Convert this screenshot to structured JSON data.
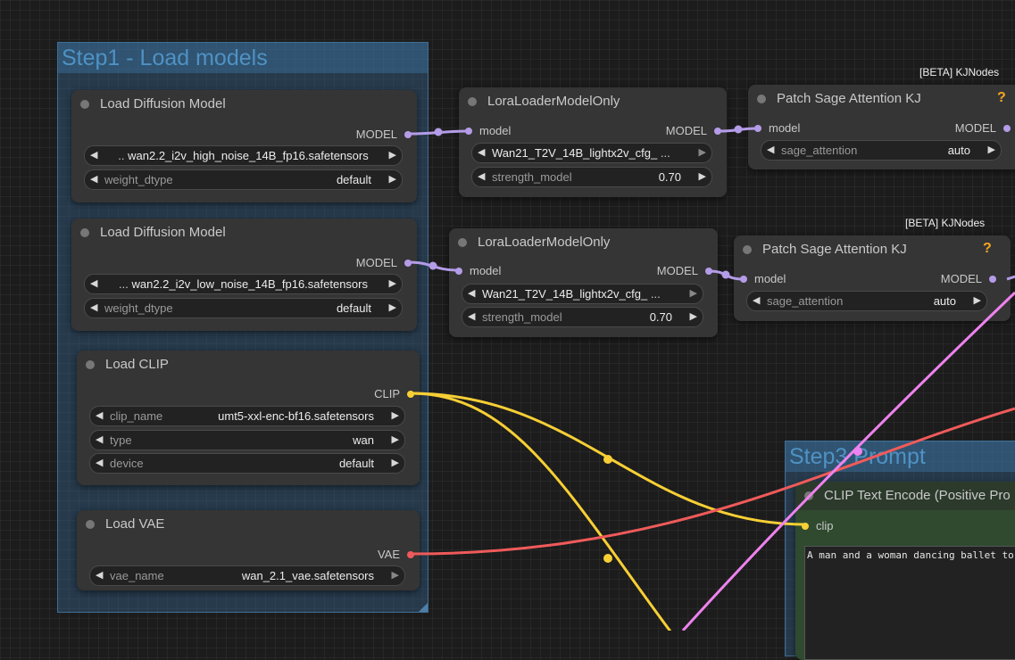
{
  "groups": {
    "step1": {
      "title": "Step1 - Load models"
    },
    "step3": {
      "title": "Step3 Prompt"
    }
  },
  "nodes": {
    "load_diffusion_high": {
      "title": "Load Diffusion Model",
      "output": "MODEL",
      "unet_name": "wan2.2_i2v_high_noise_14B_fp16.safetensors",
      "weight_dtype_label": "weight_dtype",
      "weight_dtype_value": "default"
    },
    "load_diffusion_low": {
      "title": "Load Diffusion Model",
      "output": "MODEL",
      "unet_name": "wan2.2_i2v_low_noise_14B_fp16.safetensors",
      "weight_dtype_label": "weight_dtype",
      "weight_dtype_value": "default"
    },
    "lora_high": {
      "title": "LoraLoaderModelOnly",
      "input": "model",
      "output": "MODEL",
      "lora_name": "Wan21_T2V_14B_lightx2v_cfg_",
      "strength_label": "strength_model",
      "strength_value": "0.70"
    },
    "lora_low": {
      "title": "LoraLoaderModelOnly",
      "input": "model",
      "output": "MODEL",
      "lora_name": "Wan21_T2V_14B_lightx2v_cfg_",
      "strength_label": "strength_model",
      "strength_value": "0.70"
    },
    "sage_high": {
      "title": "Patch Sage Attention KJ",
      "badge": "[BETA] KJNodes",
      "help": "?",
      "input": "model",
      "output": "MODEL",
      "attn_label": "sage_attention",
      "attn_value": "auto"
    },
    "sage_low": {
      "title": "Patch Sage Attention KJ",
      "badge": "[BETA] KJNodes",
      "help": "?",
      "input": "model",
      "output": "MODEL",
      "attn_label": "sage_attention",
      "attn_value": "auto"
    },
    "load_clip": {
      "title": "Load CLIP",
      "output": "CLIP",
      "clip_name_label": "clip_name",
      "clip_name_value": "umt5-xxl-enc-bf16.safetensors",
      "type_label": "type",
      "type_value": "wan",
      "device_label": "device",
      "device_value": "default"
    },
    "load_vae": {
      "title": "Load VAE",
      "output": "VAE",
      "vae_name_label": "vae_name",
      "vae_name_value": "wan_2.1_vae.safetensors"
    },
    "clip_text_encode": {
      "title": "CLIP Text Encode (Positive Pro",
      "input": "clip",
      "text": "A man and a woman dancing ballet to"
    }
  },
  "glyphs": {
    "left": "◀",
    "right": "▶",
    "ellipsis": "...",
    "ellipsis_short": ".."
  },
  "colors": {
    "model_wire": "#b49ce8",
    "clip_wire": "#f7cf35",
    "vae_wire": "#f05a5a",
    "pink_wire": "#ee82ee",
    "group_title": "#4f92c4"
  }
}
